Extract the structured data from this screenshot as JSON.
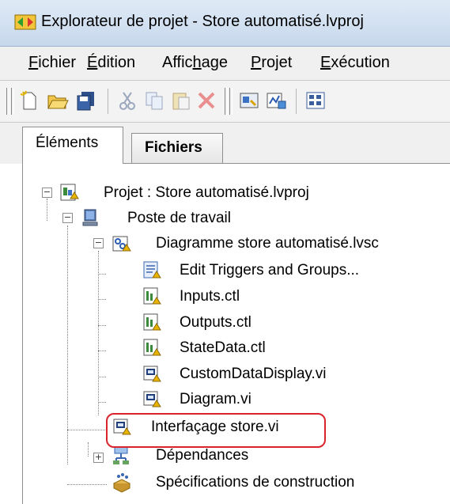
{
  "window": {
    "title": "Explorateur de projet - Store automatisé.lvproj"
  },
  "menu": [
    {
      "pre": "",
      "u": "F",
      "post": "ichier"
    },
    {
      "pre": "",
      "u": "É",
      "post": "dition"
    },
    {
      "pre": "Affic",
      "u": "h",
      "post": "age"
    },
    {
      "pre": "",
      "u": "P",
      "post": "rojet"
    },
    {
      "pre": "",
      "u": "E",
      "post": "xécution"
    }
  ],
  "tabs": {
    "elements": "Éléments",
    "files": "Fichiers"
  },
  "tree": {
    "project": "Projet : Store automatisé.lvproj",
    "workstation": "Poste de travail",
    "statechart": "Diagramme store automatisé.lvsc",
    "edit_triggers": "Edit Triggers and Groups...",
    "inputs": "Inputs.ctl",
    "outputs": "Outputs.ctl",
    "statedata": "StateData.ctl",
    "customdisplay": "CustomDataDisplay.vi",
    "diagram": "Diagram.vi",
    "interface": "Interfaçage store.vi",
    "dependencies": "Dépendances",
    "build_specs": "Spécifications de construction"
  },
  "colors": {
    "highlight": "#d9242b",
    "titlebar": "#c7d8ec"
  },
  "toolbar_icons": [
    "new-icon",
    "open-icon",
    "save-all-icon",
    "cut-icon",
    "copy-icon",
    "paste-icon",
    "delete-icon",
    "add-file-icon",
    "add-vi-icon",
    "view-icon"
  ]
}
